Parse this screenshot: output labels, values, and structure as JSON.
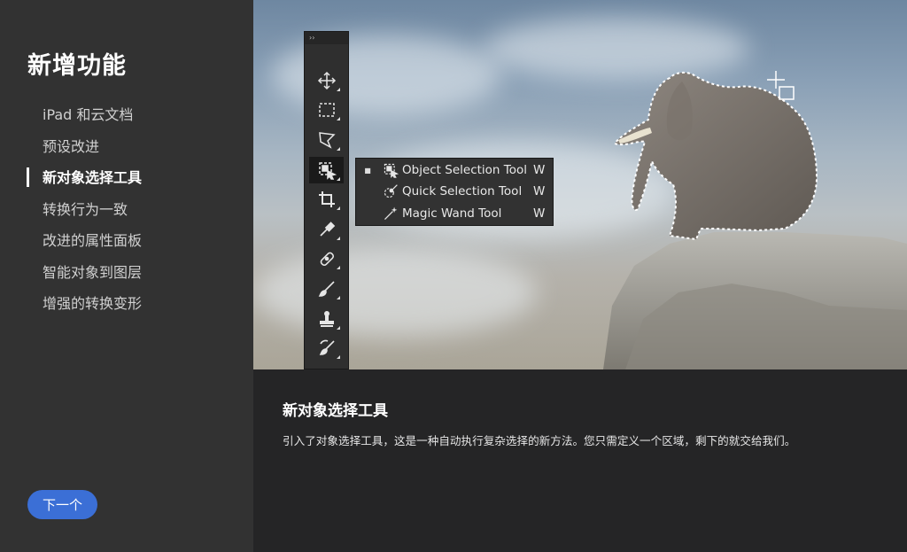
{
  "sidebar": {
    "title": "新增功能",
    "items": [
      {
        "label": "iPad 和云文档",
        "active": false
      },
      {
        "label": "预设改进",
        "active": false
      },
      {
        "label": "新对象选择工具",
        "active": true
      },
      {
        "label": "转换行为一致",
        "active": false
      },
      {
        "label": "改进的属性面板",
        "active": false
      },
      {
        "label": "智能对象到图层",
        "active": false
      },
      {
        "label": "增强的转换变形",
        "active": false
      }
    ],
    "next_label": "下一个"
  },
  "info": {
    "title": "新对象选择工具",
    "description": "引入了对象选择工具，这是一种自动执行复杂选择的新方法。您只需定义一个区域，剩下的就交给我们。"
  },
  "toolbar": {
    "collapse_glyph": "››",
    "tools": [
      "move-icon",
      "marquee-icon",
      "lasso-icon",
      "object-selection-icon",
      "crop-icon",
      "eyedropper-icon",
      "healing-icon",
      "brush-icon",
      "stamp-icon",
      "history-brush-icon"
    ],
    "selected_index": 3
  },
  "flyout": {
    "items": [
      {
        "label": "Object Selection Tool",
        "shortcut": "W",
        "icon": "object-selection-icon",
        "current_mark": "■"
      },
      {
        "label": "Quick Selection Tool",
        "shortcut": "W",
        "icon": "quick-selection-icon",
        "current_mark": ""
      },
      {
        "label": "Magic Wand Tool",
        "shortcut": "W",
        "icon": "magic-wand-icon",
        "current_mark": ""
      }
    ]
  },
  "colors": {
    "accent": "#3b6fd6",
    "sidebar_bg": "#323232",
    "info_bg": "#252526"
  }
}
